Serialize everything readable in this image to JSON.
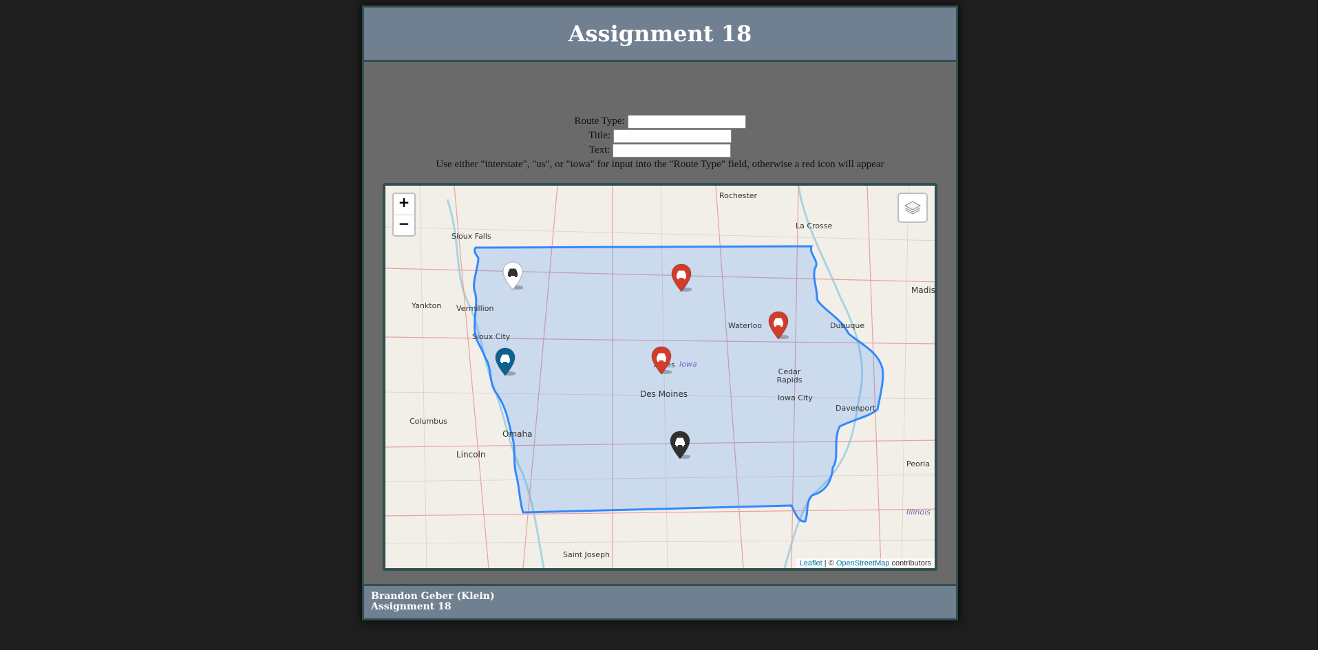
{
  "header": {
    "title": "Assignment 18"
  },
  "form": {
    "route_type_label": "Route Type:",
    "route_type_value": "",
    "title_label": "Title:",
    "title_value": "",
    "text_label": "Text:",
    "text_value": "",
    "instruction": "Use either \"interstate\", \"us\", or \"iowa\" for input into the \"Route Type\" field, otherwise a red icon will appear"
  },
  "map": {
    "zoom_in": "+",
    "zoom_out": "−",
    "layers_icon": "layers-icon",
    "attribution": {
      "leaflet": "Leaflet",
      "separator": " | © ",
      "osm": "OpenStreetMap",
      "suffix": " contributors"
    },
    "places": {
      "rochester": "Rochester",
      "la_crosse": "La Crosse",
      "sioux_falls": "Sioux Falls",
      "madison": "Madiso",
      "yankton": "Yankton",
      "vermillion": "Vermillion",
      "waterloo": "Waterloo",
      "dubuque": "Dubuque",
      "sioux_city": "Sioux City",
      "ames": "Ames",
      "iowa": "Iowa",
      "cedar_rapids": "Cedar Rapids",
      "des_moines": "Des Moines",
      "iowa_city": "Iowa City",
      "davenport": "Davenport",
      "columbus": "Columbus",
      "omaha": "Omaha",
      "lincoln": "Lincoln",
      "peoria": "Peoria",
      "illinois": "Illinois",
      "saint_joseph": "Saint Joseph"
    },
    "markers": [
      {
        "color": "#ffffff",
        "icon": "car-icon"
      },
      {
        "color": "#d13c2b",
        "icon": "car-icon"
      },
      {
        "color": "#d13c2b",
        "icon": "car-icon"
      },
      {
        "color": "#0e6192",
        "icon": "car-icon"
      },
      {
        "color": "#d13c2b",
        "icon": "car-icon"
      },
      {
        "color": "#303030",
        "icon": "car-icon"
      }
    ],
    "region_color": "#3388ff"
  },
  "footer": {
    "author": "Brandon Geber (Klein)",
    "assignment": "Assignment 18"
  }
}
